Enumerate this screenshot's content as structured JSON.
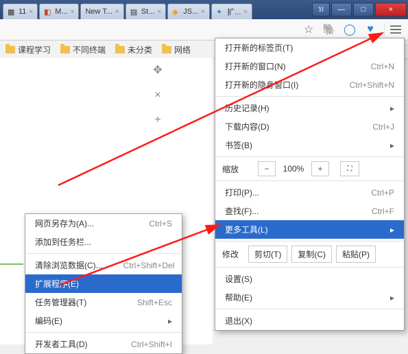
{
  "tabs": [
    {
      "label": "11"
    },
    {
      "label": "M..."
    },
    {
      "label": "New T..."
    },
    {
      "label": "St..."
    },
    {
      "label": "JS..."
    },
    {
      "label": "扩..."
    }
  ],
  "win": {
    "yi": "Yi",
    "min": "—",
    "max": "□",
    "close": "×"
  },
  "bookmarks": [
    {
      "label": "课程学习"
    },
    {
      "label": "不同终端"
    },
    {
      "label": "未分类"
    },
    {
      "label": "网络"
    }
  ],
  "main": {
    "newTab": {
      "label": "打开新的标签页(T)"
    },
    "newWin": {
      "label": "打开新的窗口(N)",
      "shortcut": "Ctrl+N"
    },
    "incog": {
      "label": "打开新的隐身窗口(I)",
      "shortcut": "Ctrl+Shift+N"
    },
    "history": {
      "label": "历史记录(H)"
    },
    "downloads": {
      "label": "下载内容(D)",
      "shortcut": "Ctrl+J"
    },
    "bookmarks": {
      "label": "书签(B)"
    },
    "zoom": {
      "label": "缩放",
      "minus": "−",
      "pct": "100%",
      "plus": "+",
      "fs": "⛶"
    },
    "print": {
      "label": "打印(P)...",
      "shortcut": "Ctrl+P"
    },
    "find": {
      "label": "查找(F)...",
      "shortcut": "Ctrl+F"
    },
    "more": {
      "label": "更多工具(L)"
    },
    "edit": {
      "label": "修改",
      "cut": "剪切(T)",
      "copy": "复制(C)",
      "paste": "粘贴(P)"
    },
    "settings": {
      "label": "设置(S)"
    },
    "help": {
      "label": "帮助(E)"
    },
    "exit": {
      "label": "退出(X)"
    }
  },
  "sub": {
    "saveAs": {
      "label": "网页另存为(A)...",
      "shortcut": "Ctrl+S"
    },
    "addToTaskbar": {
      "label": "添加到任务栏..."
    },
    "clear": {
      "label": "清除浏览数据(C)...",
      "shortcut": "Ctrl+Shift+Del"
    },
    "extensions": {
      "label": "扩展程序(E)"
    },
    "taskmgr": {
      "label": "任务管理器(T)",
      "shortcut": "Shift+Esc"
    },
    "encoding": {
      "label": "编码(E)"
    },
    "devtools": {
      "label": "开发者工具(D)",
      "shortcut": "Ctrl+Shift+I"
    }
  }
}
